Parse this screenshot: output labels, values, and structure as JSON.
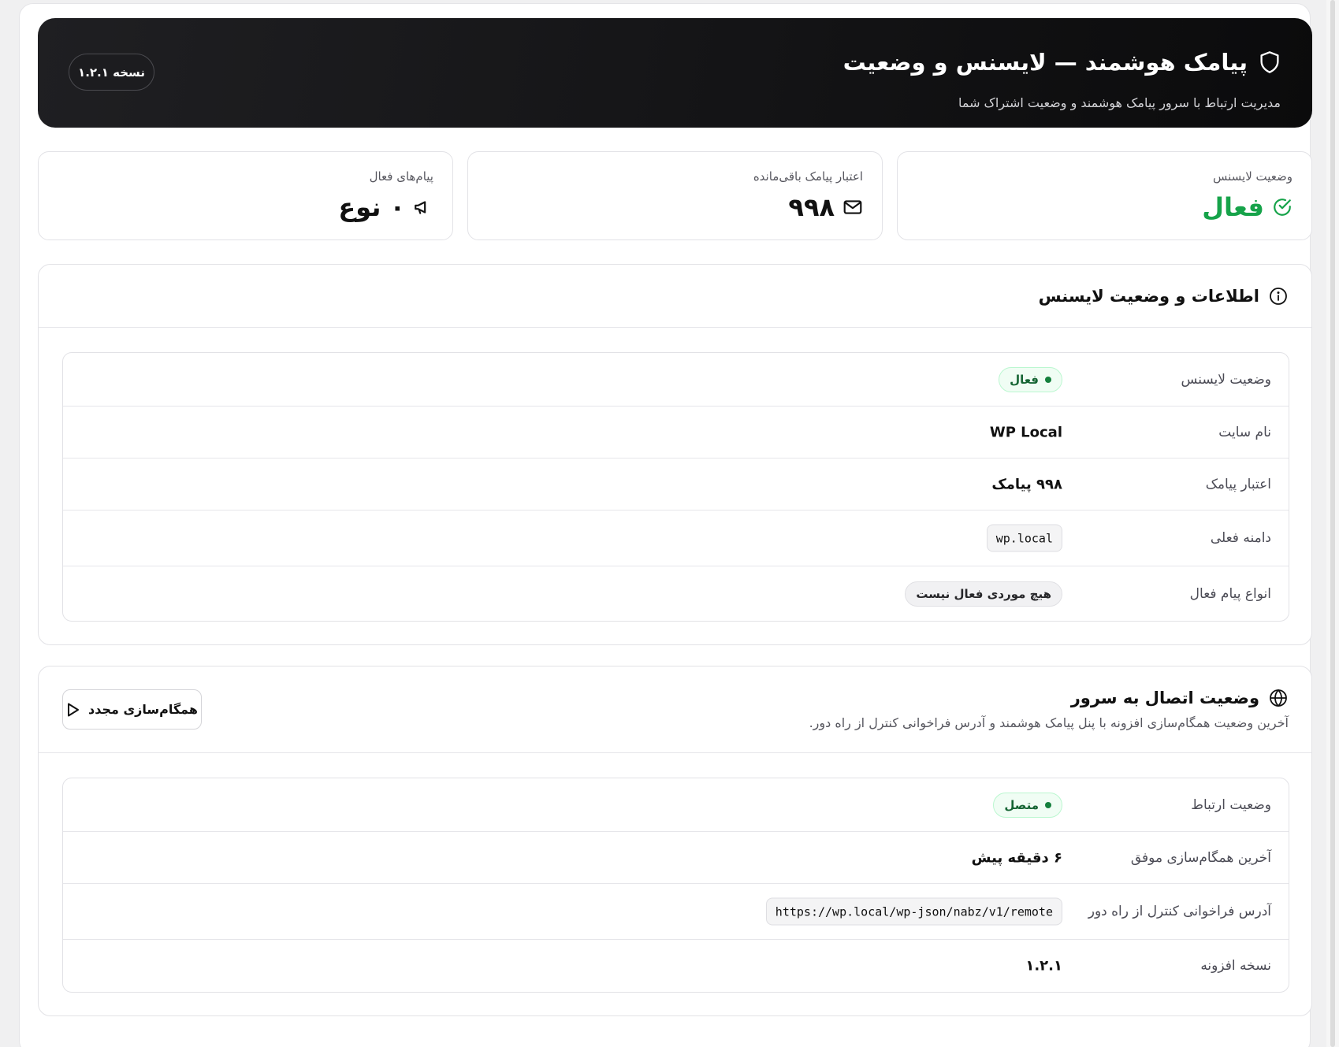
{
  "header": {
    "title": "پیامک هوشمند — لایسنس و وضعیت",
    "subtitle": "مدیریت ارتباط با سرور پیامک هوشمند و وضعیت اشتراک شما",
    "version_label": "نسخه ۱.۲.۱",
    "icon": "shield-icon"
  },
  "stats": [
    {
      "label": "وضعیت لایسنس",
      "value": "فعال",
      "icon": "check-circle-icon",
      "color": "#16a34a"
    },
    {
      "label": "اعتبار پیامک باقی‌مانده",
      "value": "۹۹۸",
      "icon": "mail-icon"
    },
    {
      "label": "پیام‌های فعال",
      "value": "۰ نوع",
      "icon": "megaphone-icon"
    }
  ],
  "license_card": {
    "title": "اطلاعات و وضعیت لایسنس",
    "icon": "info-icon",
    "rows": {
      "status": {
        "label": "وضعیت لایسنس",
        "value": "فعال"
      },
      "site_name": {
        "label": "نام سایت",
        "value": "WP Local"
      },
      "credit": {
        "label": "اعتبار پیامک",
        "value": "۹۹۸ پیامک"
      },
      "domain": {
        "label": "دامنه فعلی",
        "value": "wp.local"
      },
      "message_types": {
        "label": "انواع پیام فعال",
        "value": "هیچ موردی فعال نیست"
      }
    }
  },
  "server_card": {
    "title": "وضعیت اتصال به سرور",
    "description": "آخرین وضعیت همگام‌سازی افزونه با پنل پیامک هوشمند و آدرس فراخوانی کنترل از راه دور.",
    "icon": "globe-icon",
    "resync_label": "همگام‌سازی مجدد",
    "rows": {
      "connection": {
        "label": "وضعیت ارتباط",
        "value": "متصل"
      },
      "last_sync": {
        "label": "آخرین همگام‌سازی موفق",
        "value": "۶ دقیقه پیش"
      },
      "remote_url": {
        "label": "آدرس فراخوانی کنترل از راه دور",
        "value": "https://wp.local/wp-json/nabz/v1/remote"
      },
      "plugin_version": {
        "label": "نسخه افزونه",
        "value": "۱.۲.۱"
      }
    }
  },
  "colors": {
    "accent_green": "#16a34a",
    "hero_bg": "#141416",
    "badge_green_bg": "#f0fdf4"
  }
}
